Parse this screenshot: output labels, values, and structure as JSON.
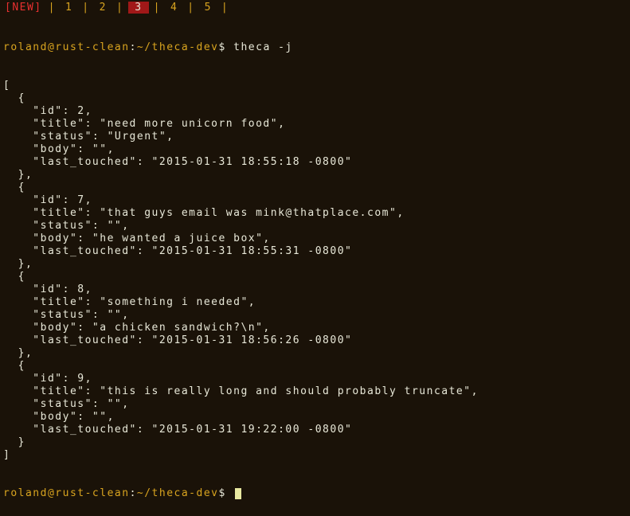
{
  "tabbar": {
    "new_label": "[NEW]",
    "tabs": [
      "1",
      "2",
      "3",
      "4",
      "5"
    ],
    "active_index": 2,
    "separator": "|"
  },
  "prompt": {
    "user_host": "roland@rust-clean",
    "sep": ":",
    "path": "~/theca-dev",
    "symbol": "$"
  },
  "command": "theca -j",
  "chart_data": {
    "type": "table",
    "title": "theca -j output",
    "columns": [
      "id",
      "title",
      "status",
      "body",
      "last_touched"
    ],
    "rows": [
      {
        "id": 2,
        "title": "need more unicorn food",
        "status": "Urgent",
        "body": "",
        "last_touched": "2015-01-31 18:55:18 -0800"
      },
      {
        "id": 7,
        "title": "that guys email was mink@thatplace.com",
        "status": "",
        "body": "he wanted a juice box",
        "last_touched": "2015-01-31 18:55:31 -0800"
      },
      {
        "id": 8,
        "title": "something i needed",
        "status": "",
        "body": "a chicken sandwich?\\n",
        "last_touched": "2015-01-31 18:56:26 -0800"
      },
      {
        "id": 9,
        "title": "this is really long and should probably truncate",
        "status": "",
        "body": "",
        "last_touched": "2015-01-31 19:22:00 -0800"
      }
    ]
  }
}
